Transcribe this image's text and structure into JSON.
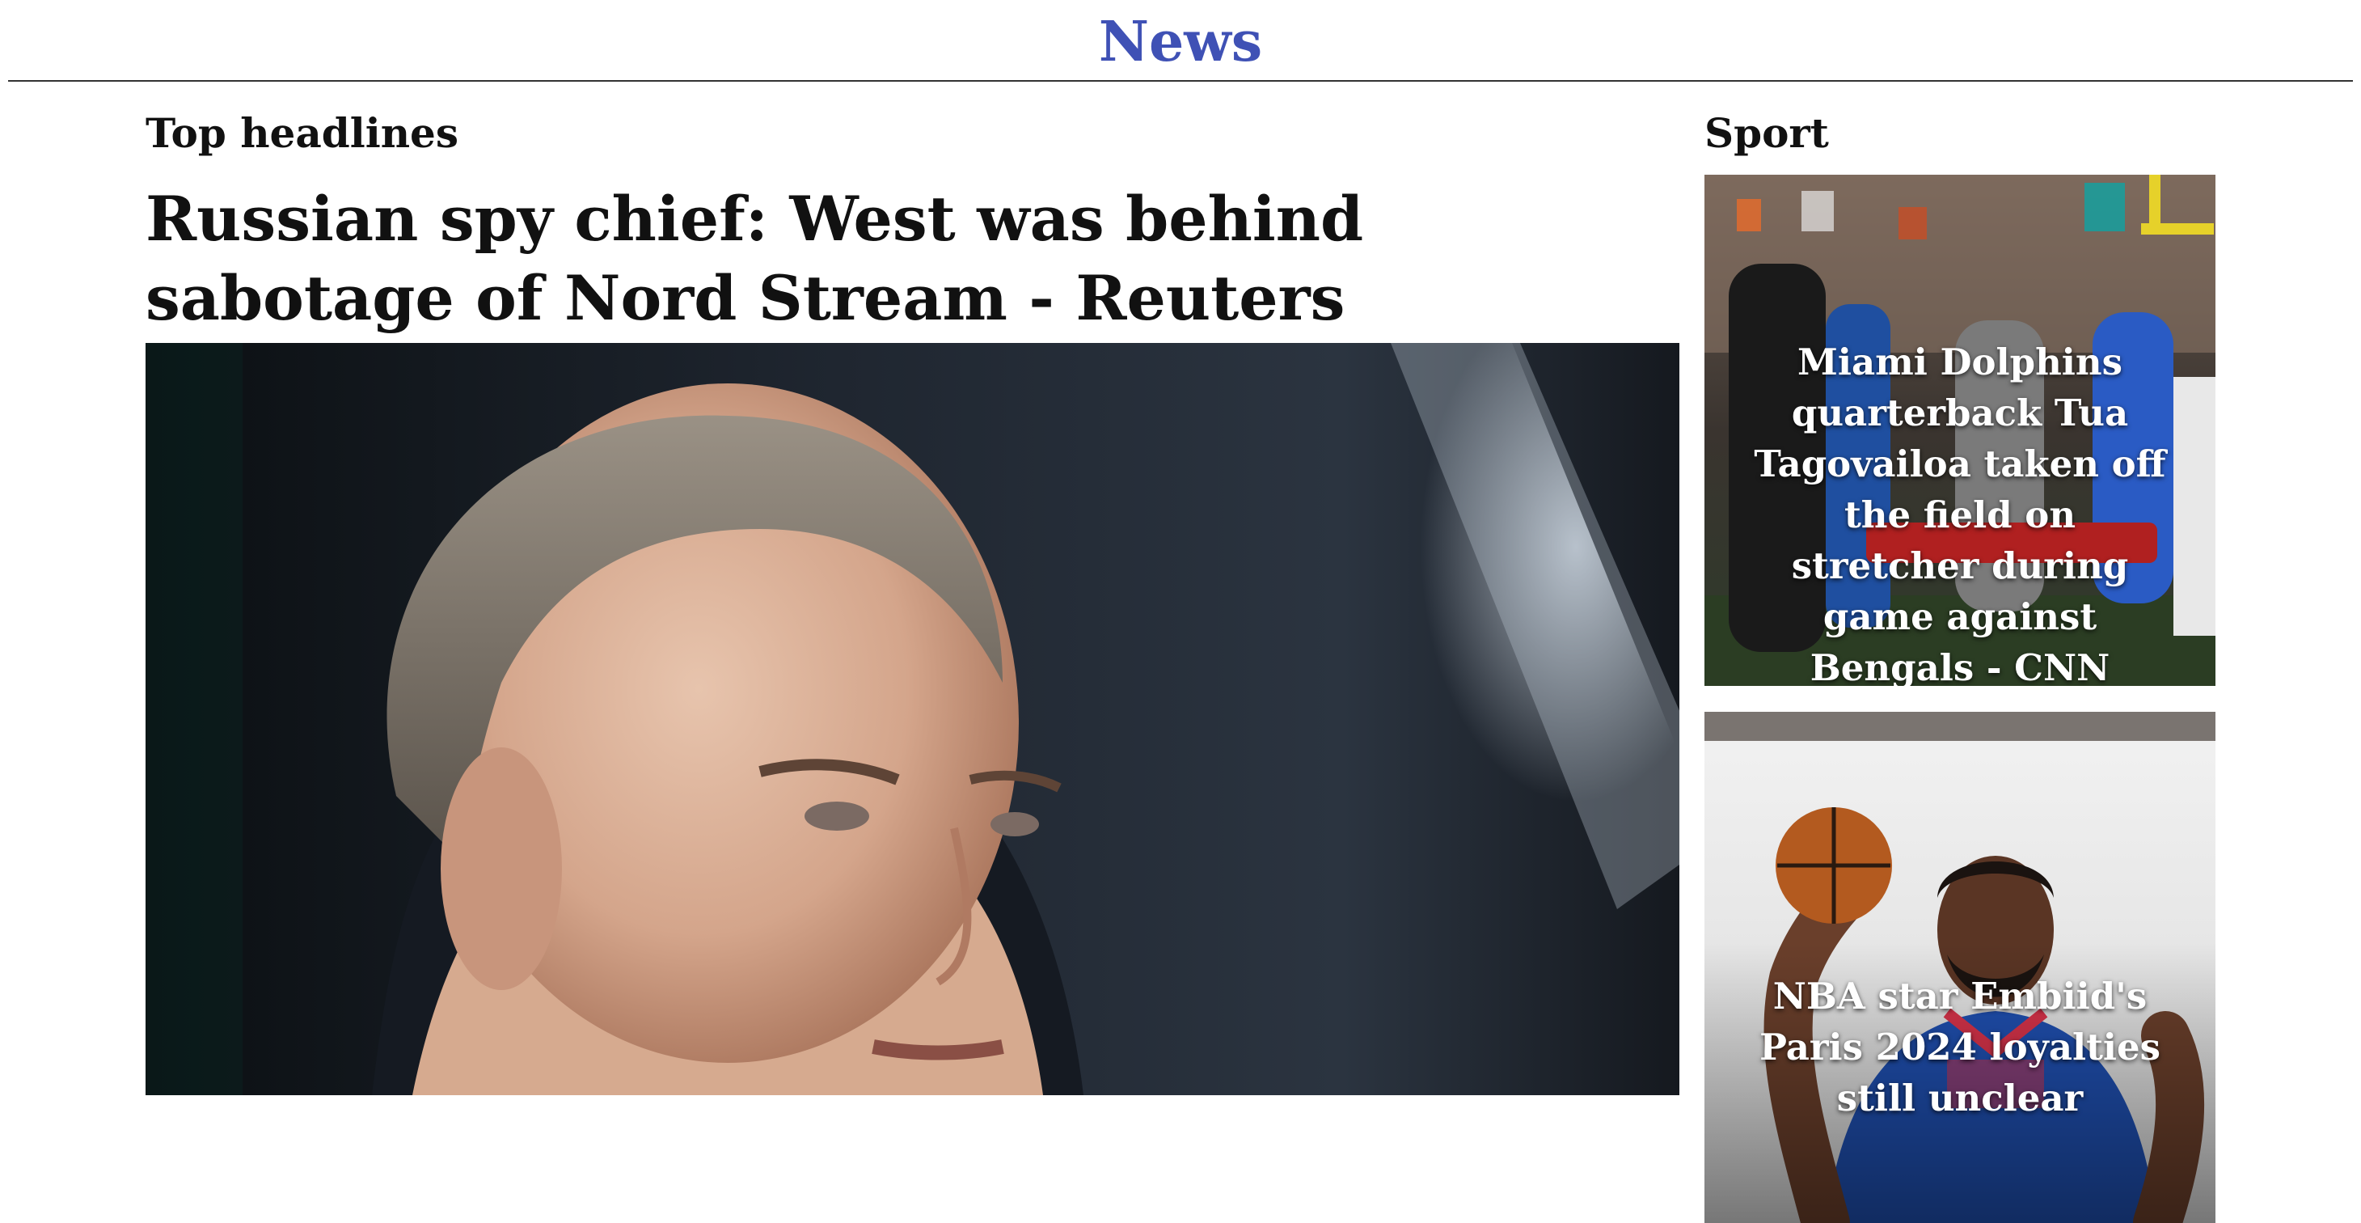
{
  "site": {
    "title": "News",
    "accent_color": "#3f51b5"
  },
  "main": {
    "section_title": "Top headlines",
    "headline": "Russian spy chief: West was behind sabotage of Nord Stream - Reuters",
    "image_icon": "photo-portrait-man"
  },
  "sidebar": {
    "section_title": "Sport",
    "cards": [
      {
        "title": "Miami Dolphins quarterback Tua Tagovailoa taken off the field on stretcher during game against Bengals - CNN",
        "image_icon": "photo-football-stretcher"
      },
      {
        "title": "NBA star Embiid's Paris 2024 loyalties still unclear",
        "image_icon": "photo-basketball-player"
      }
    ]
  }
}
